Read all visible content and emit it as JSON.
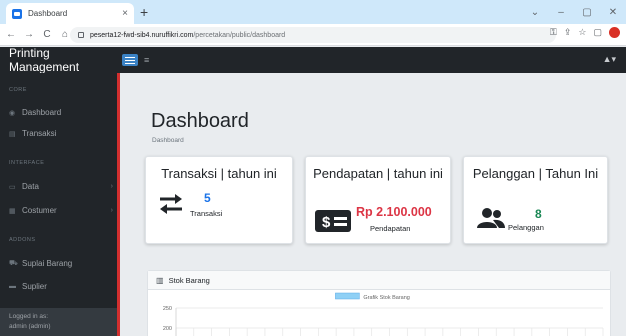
{
  "browser": {
    "tab_title": "Dashboard",
    "tab_close": "×",
    "new_tab": "+",
    "window_controls": [
      "⌄",
      "–",
      "▢",
      "✕"
    ],
    "nav": [
      "←",
      "→",
      "C",
      "⌂"
    ],
    "url_host": "peserta12-fwd-sib4.nuruffikri.com",
    "url_path": "/percetakan/public/dashboard",
    "addr_icons": [
      "⚿",
      "⇪",
      "☆",
      "▢"
    ]
  },
  "app": {
    "brand": "Printing Management",
    "hamburger": "≡",
    "user_menu": "▲▾"
  },
  "sidebar": {
    "core_heading": "CORE",
    "dashboard_icon": "◉",
    "dashboard": "Dashboard",
    "transaksi_icon": "▤",
    "transaksi": "Transaksi",
    "interface_heading": "INTERFACE",
    "data_icon": "▭",
    "data": "Data",
    "data_chevron": "›",
    "costumer_icon": "▦",
    "costumer": "Costumer",
    "costumer_chevron": "›",
    "addons_heading": "ADDONS",
    "suplai_icon": "⛟",
    "suplai": "Suplai Barang",
    "suplier_icon": "▬",
    "suplier": "Suplier",
    "footer_label": "Logged in as:",
    "footer_user": "admin (admin)"
  },
  "main": {
    "title": "Dashboard",
    "breadcrumb": "Dashboard"
  },
  "cards": {
    "transaksi": {
      "title": "Transaksi | tahun ini",
      "value": "5",
      "label": "Transaksi",
      "icon": "exchange-arrows-icon",
      "value_color": "#1a73e8"
    },
    "pendapatan": {
      "title": "Pendapatan | tahun ini",
      "value": "Rp 2.100.000",
      "label": "Pendapatan",
      "icon": "money-bill-icon",
      "value_color": "#dc3545"
    },
    "pelanggan": {
      "title": "Pelanggan | Tahun Ini",
      "value": "8",
      "label": "Pelanggan",
      "icon": "users-icon",
      "value_color": "#198754"
    }
  },
  "stok": {
    "header": "Stok Barang",
    "header_icon": "bar-chart-icon"
  },
  "chart_data": {
    "type": "bar",
    "legend": [
      "Grafik Stok Barang"
    ],
    "legend_color": "#8fd0f5",
    "y_ticks": [
      250,
      200
    ],
    "ylim": [
      0,
      250
    ],
    "grid": true,
    "categories": [],
    "values": []
  }
}
